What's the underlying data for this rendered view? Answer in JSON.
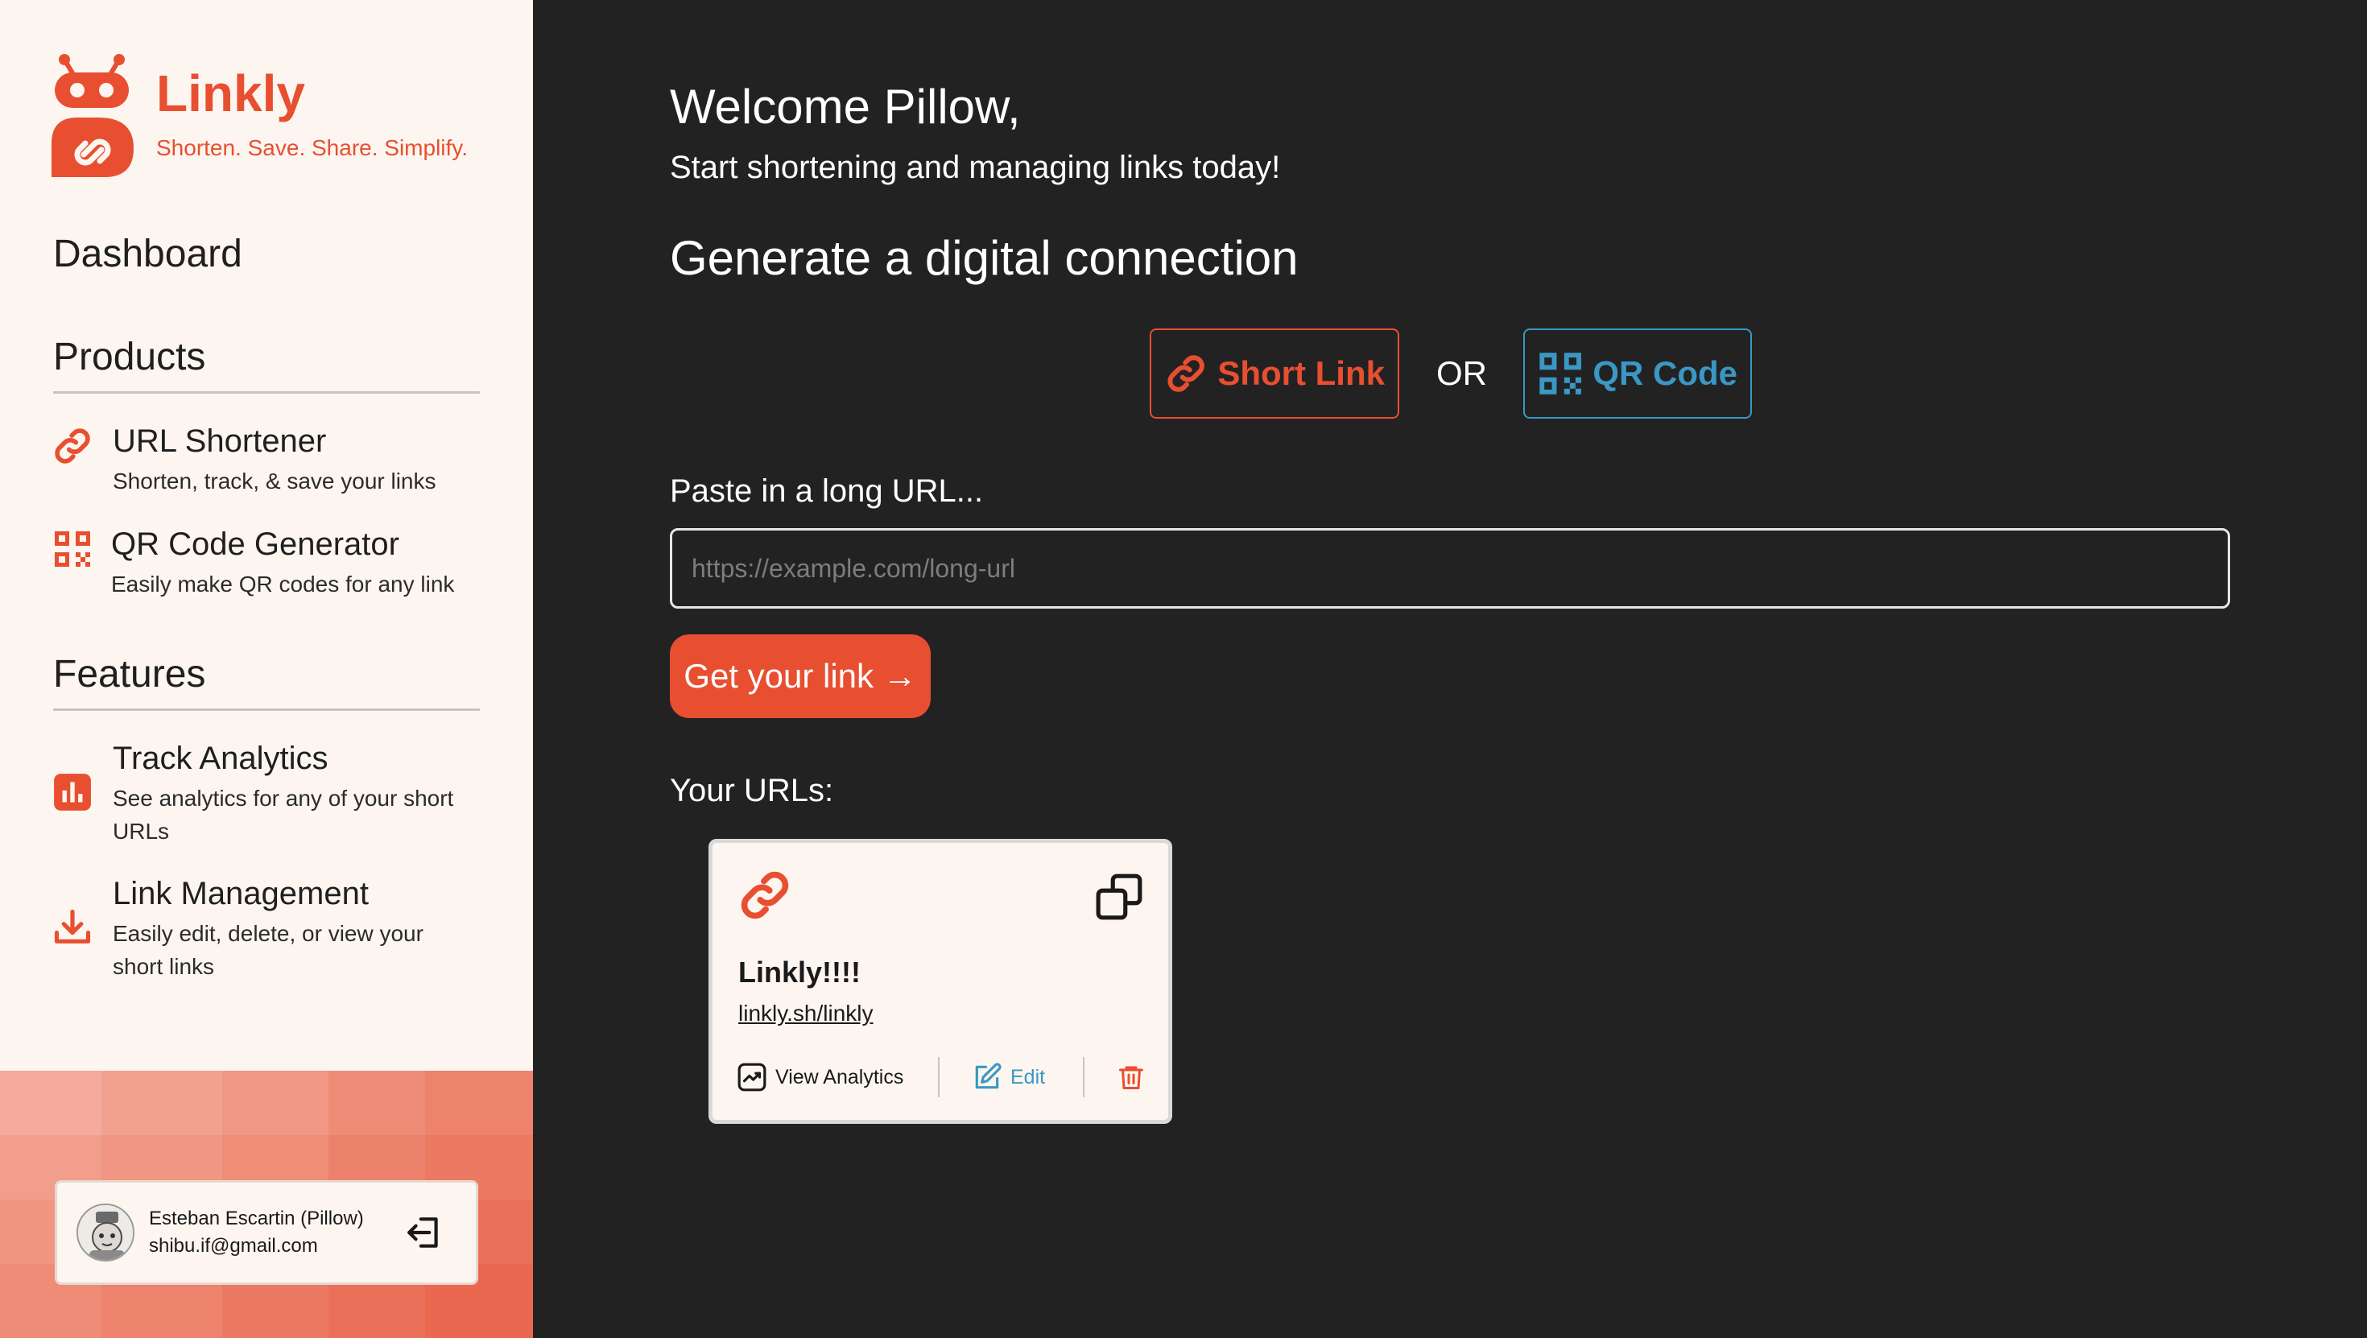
{
  "brand": {
    "name": "Linkly",
    "tagline": "Shorten. Save. Share. Simplify."
  },
  "sidebar": {
    "dashboard_label": "Dashboard",
    "products_title": "Products",
    "products": [
      {
        "title": "URL Shortener",
        "desc": "Shorten, track, & save your links",
        "icon": "link-icon"
      },
      {
        "title": "QR Code Generator",
        "desc": "Easily make QR codes for any link",
        "icon": "qr-code-icon"
      }
    ],
    "features_title": "Features",
    "features": [
      {
        "title": "Track Analytics",
        "desc": "See analytics for any of your short URLs",
        "icon": "bar-chart-icon"
      },
      {
        "title": "Link Management",
        "desc": "Easily edit, delete, or view your short links",
        "icon": "download-icon"
      }
    ]
  },
  "user": {
    "name": "Esteban Escartin (Pillow)",
    "email": "shibu.if@gmail.com"
  },
  "main": {
    "welcome": "Welcome Pillow,",
    "subtitle": "Start shortening and managing links today!",
    "generate_title": "Generate a digital connection",
    "short_link_label": "Short Link",
    "or_label": "OR",
    "qr_code_label": "QR Code",
    "url_label": "Paste in a long URL...",
    "url_placeholder": "https://example.com/long-url",
    "url_value": "",
    "get_link_label": "Get your link →",
    "your_urls_label": "Your URLs:"
  },
  "urls": [
    {
      "title": "Linkly!!!!",
      "short_url": "linkly.sh/linkly",
      "analytics_label": "View Analytics",
      "edit_label": "Edit"
    }
  ],
  "colors": {
    "accent": "#e84f31",
    "qr_blue": "#3b97c4",
    "sidebar_bg": "#fdf6f0",
    "main_bg": "#232223"
  }
}
